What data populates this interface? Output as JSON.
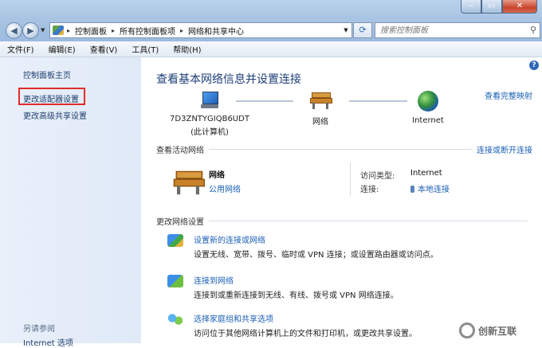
{
  "window": {
    "minimize_glyph": "‒",
    "maximize_glyph": "▭",
    "close_glyph": "✕"
  },
  "address_bar": {
    "breadcrumbs": [
      "控制面板",
      "所有控制面板项",
      "网络和共享中心"
    ],
    "separator": "▸",
    "search_placeholder": "搜索控制面板"
  },
  "menu": [
    "文件(F)",
    "编辑(E)",
    "查看(V)",
    "工具(T)",
    "帮助(H)"
  ],
  "sidebar": {
    "home": "控制面板主页",
    "items": [
      "更改适配器设置",
      "更改高级共享设置"
    ],
    "see_also_title": "另请参阅",
    "see_also_items": [
      "Internet 选项"
    ]
  },
  "main": {
    "title": "查看基本网络信息并设置连接",
    "full_map": "查看完整映射",
    "nodes": {
      "computer": "7D3ZNTYGIQB6UDT",
      "computer_sub": "(此计算机)",
      "network": "网络",
      "internet": "Internet"
    },
    "active_section": {
      "title": "查看活动网络",
      "right_link": "连接或断开连接",
      "network_name": "网络",
      "network_type": "公用网络",
      "access_type_label": "访问类型:",
      "access_type_value": "Internet",
      "connections_label": "连接:",
      "connections_value": "本地连接"
    },
    "change_section": {
      "title": "更改网络设置",
      "tasks": [
        {
          "title": "设置新的连接或网络",
          "desc": "设置无线、宽带、拨号、临时或 VPN 连接；或设置路由器或访问点。"
        },
        {
          "title": "连接到网络",
          "desc": "连接到或重新连接到无线、有线、拨号或 VPN 网络连接。"
        },
        {
          "title": "选择家庭组和共享选项",
          "desc": "访问位于其他网络计算机上的文件和打印机，或更改共享设置。"
        }
      ]
    }
  },
  "watermark": {
    "text": "创新互联"
  },
  "colors": {
    "link": "#1a5fb4",
    "title": "#1e3f78",
    "highlight_border": "#e22b2b",
    "sidebar_bg": "#e3ecf8"
  }
}
